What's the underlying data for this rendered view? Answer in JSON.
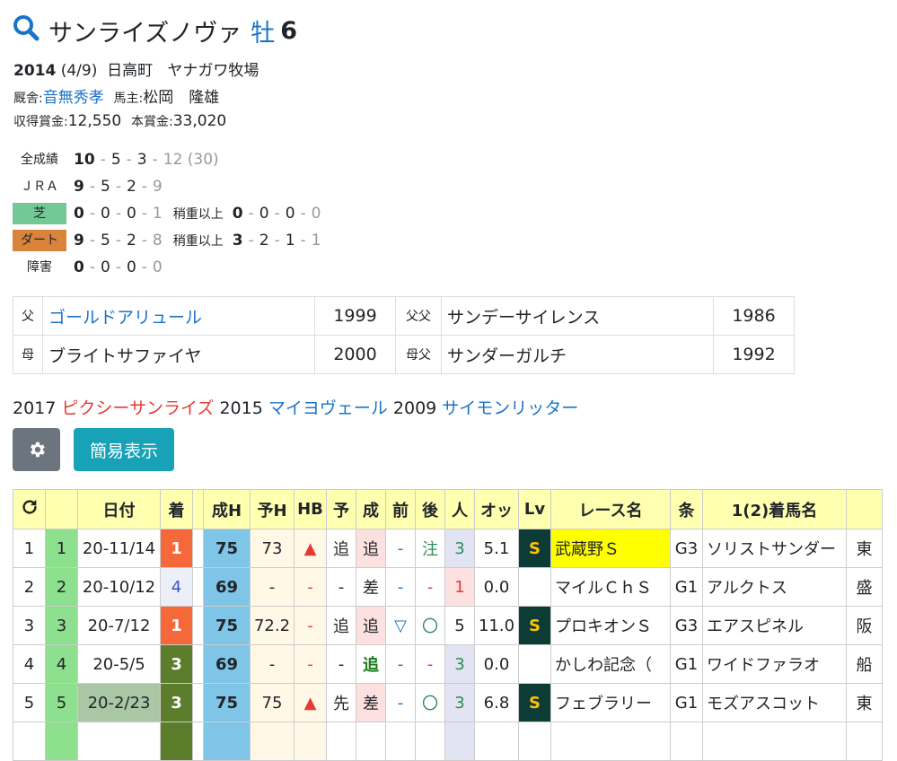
{
  "horse": {
    "name": "サンライズノヴァ",
    "sex": "牡",
    "age": "6"
  },
  "info": {
    "birth_year": "2014",
    "birth_date": "(4/9)",
    "region": "日高町",
    "breeder": "ヤナガワ牧場",
    "trainer_label": "厩舎:",
    "trainer": "音無秀孝",
    "owner_label": "馬主:",
    "owner": "松岡　隆雄",
    "earnings_label": "収得賞金:",
    "earnings": "12,550",
    "prize_label": "本賞金:",
    "prize": "33,020"
  },
  "record": {
    "all": {
      "label": "全成績",
      "v": [
        "10",
        "5",
        "3",
        "12"
      ],
      "extra": "(30)"
    },
    "jra": {
      "label": "ＪＲＡ",
      "v": [
        "9",
        "5",
        "2",
        "9"
      ]
    },
    "turf": {
      "label": "芝",
      "v": [
        "0",
        "0",
        "0",
        "1"
      ],
      "sub_label": "稍重以上",
      "sub": [
        "0",
        "0",
        "0",
        "0"
      ]
    },
    "dirt": {
      "label": "ダート",
      "v": [
        "9",
        "5",
        "2",
        "8"
      ],
      "sub_label": "稍重以上",
      "sub": [
        "3",
        "2",
        "1",
        "1"
      ]
    },
    "jump": {
      "label": "障害",
      "v": [
        "0",
        "0",
        "0",
        "0"
      ]
    }
  },
  "pedigree": {
    "father_label": "父",
    "father": "ゴールドアリュール",
    "father_year": "1999",
    "ff_label": "父父",
    "ff": "サンデーサイレンス",
    "ff_year": "1986",
    "mother_label": "母",
    "mother": "ブライトサファイヤ",
    "mother_year": "2000",
    "mf_label": "母父",
    "mf": "サンダーガルチ",
    "mf_year": "1992"
  },
  "siblings": [
    {
      "year": "2017",
      "name": "ピクシーサンライズ",
      "color": "#e53935"
    },
    {
      "year": "2015",
      "name": "マイヨヴェール",
      "color": "#1a73c9"
    },
    {
      "year": "2009",
      "name": "サイモンリッター",
      "color": "#1a73c9"
    }
  ],
  "buttons": {
    "simple": "簡易表示"
  },
  "table": {
    "headers": [
      "日付",
      "着",
      "成H",
      "予H",
      "HB",
      "予",
      "成",
      "前",
      "後",
      "人",
      "オッ",
      "Lv",
      "レース名",
      "条",
      "1(2)着馬名"
    ],
    "rows": [
      {
        "no": "1",
        "gate": "1",
        "date": "20-11/14",
        "pos": "1",
        "rating": "75",
        "yoso": "73",
        "hb": "▲",
        "yo": "追",
        "sei": "追",
        "mae": "-",
        "ato": "注",
        "nin": "3",
        "odds": "5.1",
        "lv": "S",
        "race": "武蔵野Ｓ",
        "grade": "G3",
        "winner": "ソリストサンダー",
        "more": "東"
      },
      {
        "no": "2",
        "gate": "2",
        "date": "20-10/12",
        "pos": "4",
        "rating": "69",
        "yoso": "-",
        "hb": "-",
        "yo": "-",
        "sei": "差",
        "mae": "-",
        "ato": "-",
        "nin": "1",
        "odds": "0.0",
        "lv": "",
        "race": "マイルＣｈＳ",
        "grade": "G1",
        "winner": "アルクトス",
        "more": "盛"
      },
      {
        "no": "3",
        "gate": "3",
        "date": "20-7/12",
        "pos": "1",
        "rating": "75",
        "yoso": "72.2",
        "hb": "-",
        "yo": "追",
        "sei": "追",
        "mae": "▽",
        "ato": "〇",
        "nin": "5",
        "odds": "11.0",
        "lv": "S",
        "race": "プロキオンＳ",
        "grade": "G3",
        "winner": "エアスピネル",
        "more": "阪"
      },
      {
        "no": "4",
        "gate": "4",
        "date": "20-5/5",
        "pos": "3",
        "rating": "69",
        "yoso": "-",
        "hb": "-",
        "yo": "-",
        "sei": "追",
        "mae": "-",
        "ato": "-",
        "nin": "3",
        "odds": "0.0",
        "lv": "",
        "race": "かしわ記念（",
        "grade": "G1",
        "winner": "ワイドファラオ",
        "more": "船"
      },
      {
        "no": "5",
        "gate": "5",
        "date": "20-2/23",
        "pos": "3",
        "rating": "75",
        "yoso": "75",
        "hb": "▲",
        "yo": "先",
        "sei": "差",
        "mae": "-",
        "ato": "〇",
        "nin": "3",
        "odds": "6.8",
        "lv": "S",
        "race": "フェブラリー",
        "grade": "G1",
        "winner": "モズアスコット",
        "more": "東"
      }
    ]
  }
}
